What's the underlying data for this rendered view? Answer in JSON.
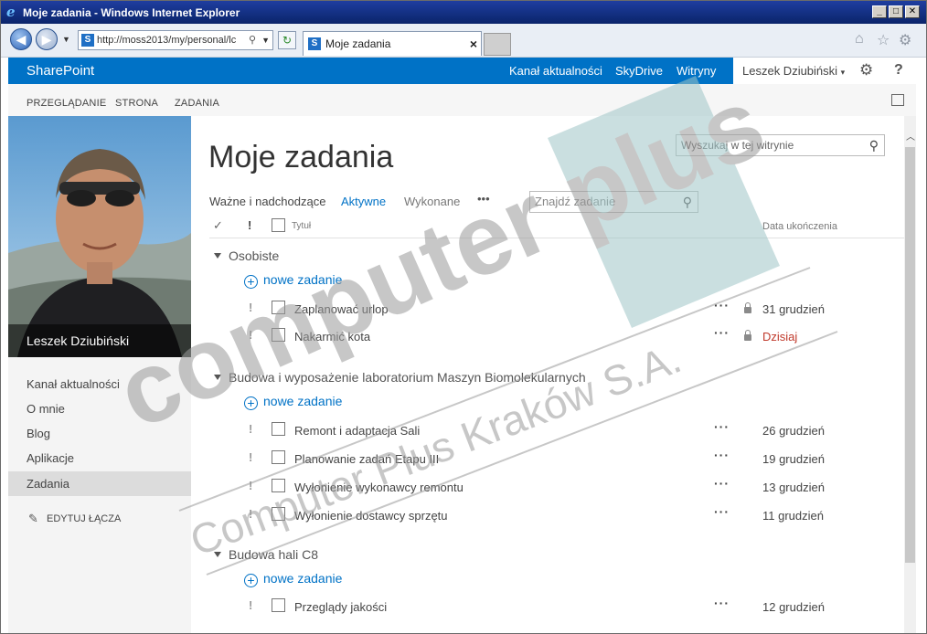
{
  "window": {
    "title": "Moje zadania - Windows Internet Explorer",
    "address": "http://moss2013/my/personal/lc",
    "tab_title": "Moje zadania"
  },
  "suitebar": {
    "brand": "SharePoint",
    "links": [
      "Kanał aktualności",
      "SkyDrive",
      "Witryny"
    ],
    "user": "Leszek Dziubiński"
  },
  "ribbon": {
    "tabs": [
      "PRZEGLĄDANIE",
      "STRONA",
      "ZADANIA"
    ]
  },
  "profile": {
    "name": "Leszek Dziubiński"
  },
  "leftnav": {
    "items": [
      "Kanał aktualności",
      "O mnie",
      "Blog",
      "Aplikacje",
      "Zadania"
    ],
    "edit_links": "EDYTUJ ŁĄCZA"
  },
  "main": {
    "title": "Moje zadania",
    "site_search_placeholder": "Wyszukaj w tej witrynie",
    "views": [
      "Ważne i nadchodzące",
      "Aktywne",
      "Wykonane"
    ],
    "view_more": "•••",
    "find_task_placeholder": "Znajdź zadanie",
    "columns": {
      "check": "✓",
      "important": "!",
      "title": "Tytuł",
      "due": "Data ukończenia"
    },
    "new_task_label": "nowe zadanie",
    "groups": [
      {
        "name": "Osobiste",
        "tasks": [
          {
            "title": "Zaplanować urlop",
            "due": "31 grudzień",
            "locked": true,
            "due_color": "#444444"
          },
          {
            "title": "Nakarmić kota",
            "due": "Dzisiaj",
            "locked": true,
            "due_color": "#c0392b"
          }
        ]
      },
      {
        "name": "Budowa i wyposażenie laboratorium Maszyn Biomolekularnych",
        "tasks": [
          {
            "title": "Remont i adaptacja Sali",
            "due": "26 grudzień"
          },
          {
            "title": "Planowanie zadań Etapu III",
            "due": "19 grudzień"
          },
          {
            "title": "Wyłonienie wykonawcy remontu",
            "due": "13 grudzień"
          },
          {
            "title": "Wyłonienie dostawcy sprzętu",
            "due": "11 grudzień"
          }
        ]
      },
      {
        "name": "Budowa hali C8",
        "tasks": [
          {
            "title": "Przeglądy jakości",
            "due": "12 grudzień"
          }
        ]
      }
    ]
  },
  "watermark": {
    "logo": "computer plus",
    "line": "Computer Plus Kraków S.A."
  },
  "colors": {
    "suitebar": "#0072c6",
    "accent": "#0072c6",
    "today": "#c0392b"
  }
}
